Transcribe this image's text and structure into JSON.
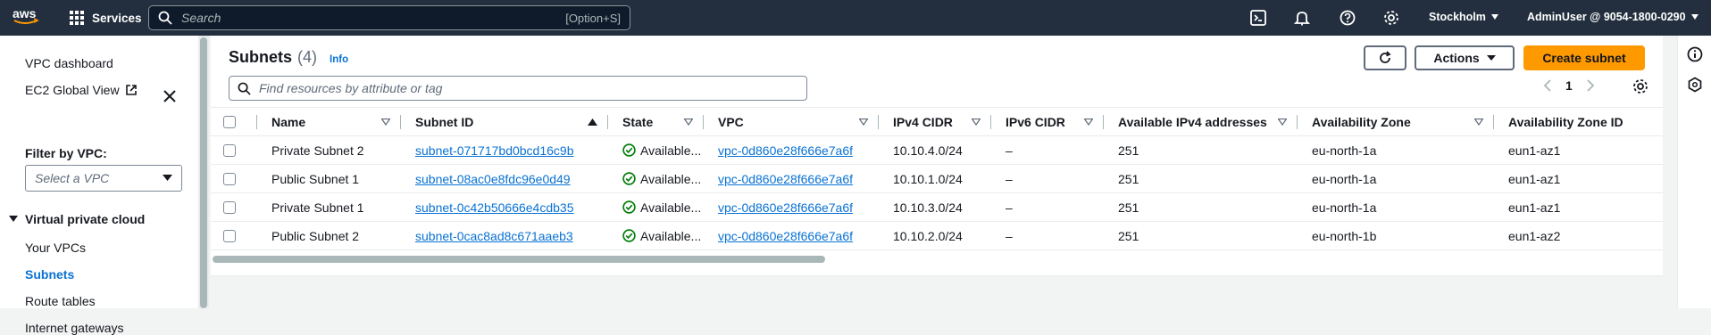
{
  "topnav": {
    "services_label": "Services",
    "search_placeholder": "Search",
    "search_shortcut": "[Option+S]",
    "region": "Stockholm",
    "account": "AdminUser @ 9054-1800-0290"
  },
  "sidebar": {
    "vpc_dashboard": "VPC dashboard",
    "ec2_global_view": "EC2 Global View",
    "filter_label": "Filter by VPC:",
    "filter_placeholder": "Select a VPC",
    "section_title": "Virtual private cloud",
    "items": [
      {
        "label": "Your VPCs"
      },
      {
        "label": "Subnets"
      },
      {
        "label": "Route tables"
      },
      {
        "label": "Internet gateways"
      }
    ]
  },
  "main": {
    "title": "Subnets",
    "count": "(4)",
    "info": "Info",
    "actions_label": "Actions",
    "create_label": "Create subnet",
    "filter_placeholder": "Find resources by attribute or tag",
    "page": "1",
    "columns": [
      "Name",
      "Subnet ID",
      "State",
      "VPC",
      "IPv4 CIDR",
      "IPv6 CIDR",
      "Available IPv4 addresses",
      "Availability Zone",
      "Availability Zone ID"
    ],
    "rows": [
      {
        "name": "Private Subnet 2",
        "subnet_id": "subnet-071717bd0bcd16c9b",
        "state": "Available...",
        "vpc": "vpc-0d860e28f666e7a6f",
        "ipv4": "10.10.4.0/24",
        "ipv6": "–",
        "available_ips": "251",
        "az": "eu-north-1a",
        "az_id": "eun1-az1"
      },
      {
        "name": "Public Subnet 1",
        "subnet_id": "subnet-08ac0e8fdc96e0d49",
        "state": "Available...",
        "vpc": "vpc-0d860e28f666e7a6f",
        "ipv4": "10.10.1.0/24",
        "ipv6": "–",
        "available_ips": "251",
        "az": "eu-north-1a",
        "az_id": "eun1-az1"
      },
      {
        "name": "Private Subnet 1",
        "subnet_id": "subnet-0c42b50666e4cdb35",
        "state": "Available...",
        "vpc": "vpc-0d860e28f666e7a6f",
        "ipv4": "10.10.3.0/24",
        "ipv6": "–",
        "available_ips": "251",
        "az": "eu-north-1a",
        "az_id": "eun1-az1"
      },
      {
        "name": "Public Subnet 2",
        "subnet_id": "subnet-0cac8ad8c671aaeb3",
        "state": "Available...",
        "vpc": "vpc-0d860e28f666e7a6f",
        "ipv4": "10.10.2.0/24",
        "ipv6": "–",
        "available_ips": "251",
        "az": "eu-north-1b",
        "az_id": "eun1-az2"
      }
    ]
  },
  "colors": {
    "nav_bg": "#232f3e",
    "accent": "#0972d3",
    "primary_button": "#ff9900",
    "success": "#037f0c"
  }
}
